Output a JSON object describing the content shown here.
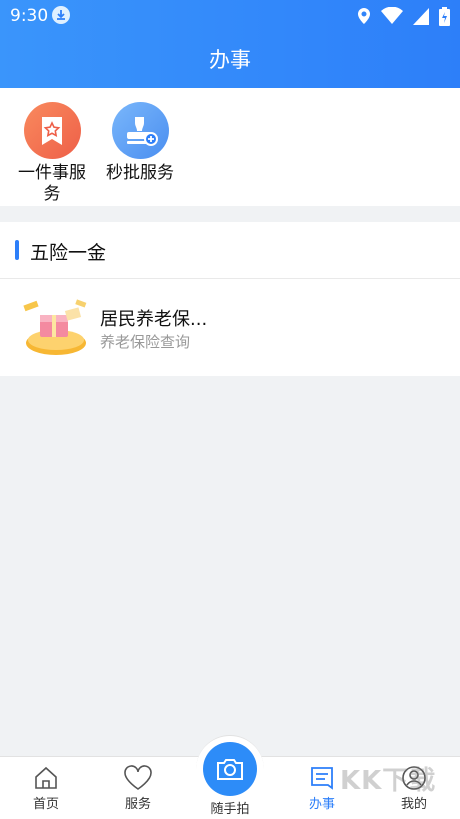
{
  "status": {
    "time": "9:30"
  },
  "header": {
    "title": "办事"
  },
  "quick_actions": [
    {
      "label": "一件事服务",
      "icon": "star-ribbon-icon"
    },
    {
      "label": "秒批服务",
      "icon": "stamp-icon"
    }
  ],
  "section": {
    "title": "五险一金",
    "items": [
      {
        "name": "居民养老保...",
        "subtitle": "养老保险查询",
        "icon": "pension-gift-icon"
      }
    ]
  },
  "tabbar": {
    "tabs": [
      {
        "label": "首页",
        "icon": "home-icon"
      },
      {
        "label": "服务",
        "icon": "heart-icon"
      },
      {
        "label": "随手拍",
        "icon": "camera-icon"
      },
      {
        "label": "办事",
        "icon": "document-icon",
        "active": true
      },
      {
        "label": "我的",
        "icon": "user-icon"
      }
    ]
  },
  "watermark": "KK下载",
  "colors": {
    "accent": "#2d7ff9",
    "header": "#3a95fb",
    "quick_orange": "#f26a4b",
    "quick_blue": "#5a9ef5"
  }
}
